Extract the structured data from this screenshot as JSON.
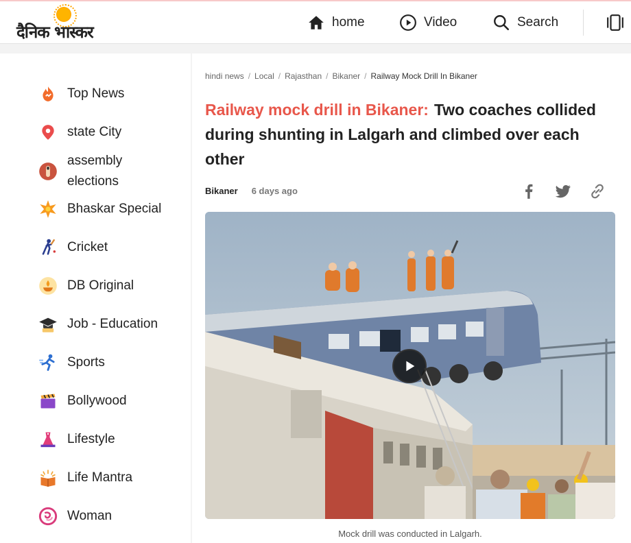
{
  "header": {
    "logo_text": "दैनिक भास्कर",
    "nav": [
      {
        "label": "home",
        "icon": "home-icon"
      },
      {
        "label": "Video",
        "icon": "play-circle-icon"
      },
      {
        "label": "Search",
        "icon": "search-icon"
      }
    ],
    "menu_icon": "side-panel-icon"
  },
  "sidebar": {
    "items": [
      {
        "label": "Top News",
        "icon": "flame-icon"
      },
      {
        "label": "state City",
        "icon": "location-pin-icon"
      },
      {
        "label": "assembly elections",
        "icon": "ink-finger-icon"
      },
      {
        "label": "Bhaskar Special",
        "icon": "star-burst-icon"
      },
      {
        "label": "Cricket",
        "icon": "cricket-player-icon"
      },
      {
        "label": "DB Original",
        "icon": "lamp-icon"
      },
      {
        "label": "Job - Education",
        "icon": "graduation-cap-icon"
      },
      {
        "label": "Sports",
        "icon": "runner-icon"
      },
      {
        "label": "Bollywood",
        "icon": "clapperboard-icon"
      },
      {
        "label": "Lifestyle",
        "icon": "dress-icon"
      },
      {
        "label": "Life Mantra",
        "icon": "book-glow-icon"
      },
      {
        "label": "Woman",
        "icon": "woman-swirl-icon"
      }
    ]
  },
  "article": {
    "breadcrumb": [
      "hindi news",
      "Local",
      "Rajasthan",
      "Bikaner",
      "Railway Mock Drill In Bikaner"
    ],
    "kicker": "Railway mock drill in Bikaner:",
    "headline": "Two coaches collided during shunting in Lalgarh and climbed over each other",
    "location": "Bikaner",
    "time": "6 days ago",
    "share": [
      "facebook-icon",
      "twitter-icon",
      "link-icon"
    ],
    "caption": "Mock drill was conducted in Lalgarh."
  },
  "colors": {
    "accent": "#e8574b",
    "logo_sun": "#ffb400"
  }
}
